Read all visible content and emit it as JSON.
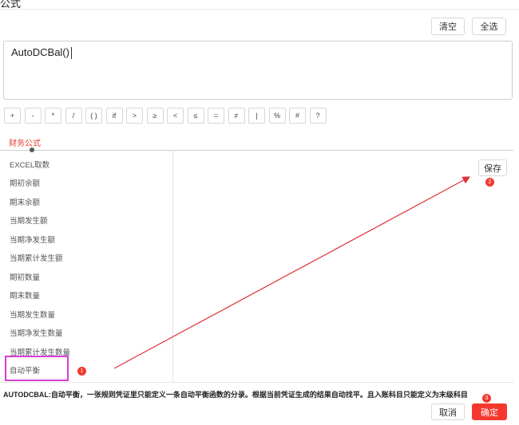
{
  "window": {
    "title_fragment": "公式"
  },
  "toolbar": {
    "clear_label": "清空",
    "select_all_label": "全选"
  },
  "formula": {
    "value": "AutoDCBal()"
  },
  "operators": [
    "+",
    "-",
    "*",
    "/",
    "( )",
    "if",
    ">",
    "≥",
    "<",
    "≤",
    "=",
    "≠",
    "|",
    "%",
    "#",
    "?"
  ],
  "tabs": {
    "active": "财务公式"
  },
  "functions": [
    "EXCEL取数",
    "期初余额",
    "期末余额",
    "当期发生额",
    "当期净发生额",
    "当期累计发生额",
    "期初数量",
    "期末数量",
    "当期发生数量",
    "当期净发生数量",
    "当期累计发生数量",
    "自动平衡"
  ],
  "panel": {
    "save_label": "保存"
  },
  "description": "AUTODCBAL:自动平衡，一张规则凭证里只能定义一条自动平衡函数的分录。根据当前凭证生成的结果自动找平。且入账科目只能定义为末级科目",
  "footer": {
    "cancel_label": "取消",
    "confirm_label": "确定"
  },
  "annotations": {
    "badge_1": "1",
    "badge_2": "2",
    "badge_3": "3"
  },
  "colors": {
    "accent": "#f5382e",
    "highlight_box": "#d63dd6",
    "arrow": "#e0303a"
  }
}
